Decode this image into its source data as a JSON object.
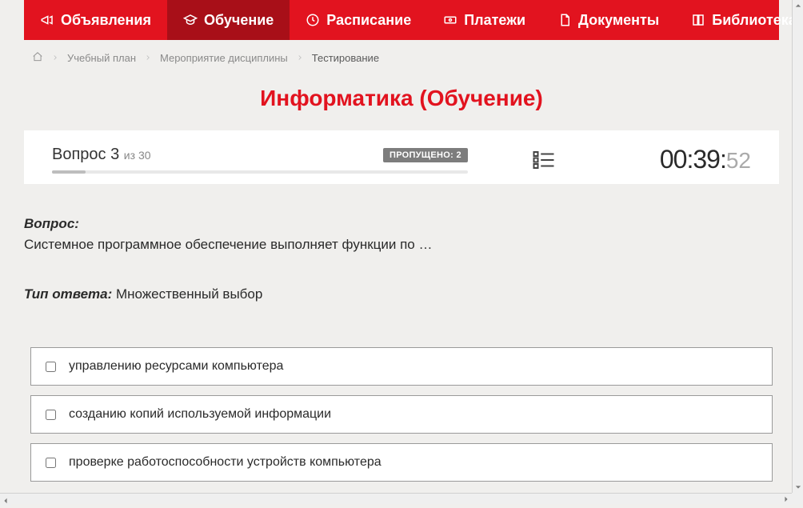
{
  "nav": {
    "items": [
      {
        "label": "Объявления",
        "icon": "megaphone-icon",
        "active": false
      },
      {
        "label": "Обучение",
        "icon": "graduation-cap-icon",
        "active": true
      },
      {
        "label": "Расписание",
        "icon": "clock-icon",
        "active": false
      },
      {
        "label": "Платежи",
        "icon": "money-icon",
        "active": false
      },
      {
        "label": "Документы",
        "icon": "document-icon",
        "active": false
      },
      {
        "label": "Библиотека",
        "icon": "book-icon",
        "active": false,
        "dropdown": true
      }
    ]
  },
  "breadcrumb": {
    "items": [
      {
        "label": "Учебный план"
      },
      {
        "label": "Мероприятие дисциплины"
      }
    ],
    "current": "Тестирование"
  },
  "page_title": "Информатика (Обучение)",
  "status": {
    "question_label": "Вопрос",
    "question_num": "3",
    "of_label": "из",
    "total": "30",
    "skipped_label": "ПРОПУЩЕНО: 2",
    "timer_main": "00:39:",
    "timer_sec": "52"
  },
  "question": {
    "label": "Вопрос:",
    "text": "Системное программное обеспечение выполняет функции по …"
  },
  "answer_type": {
    "label": "Тип ответа:",
    "value": "Множественный выбор"
  },
  "answers": [
    {
      "text": "управлению ресурсами компьютера"
    },
    {
      "text": "созданию копий используемой информации"
    },
    {
      "text": "проверке работоспособности устройств компьютера"
    }
  ]
}
